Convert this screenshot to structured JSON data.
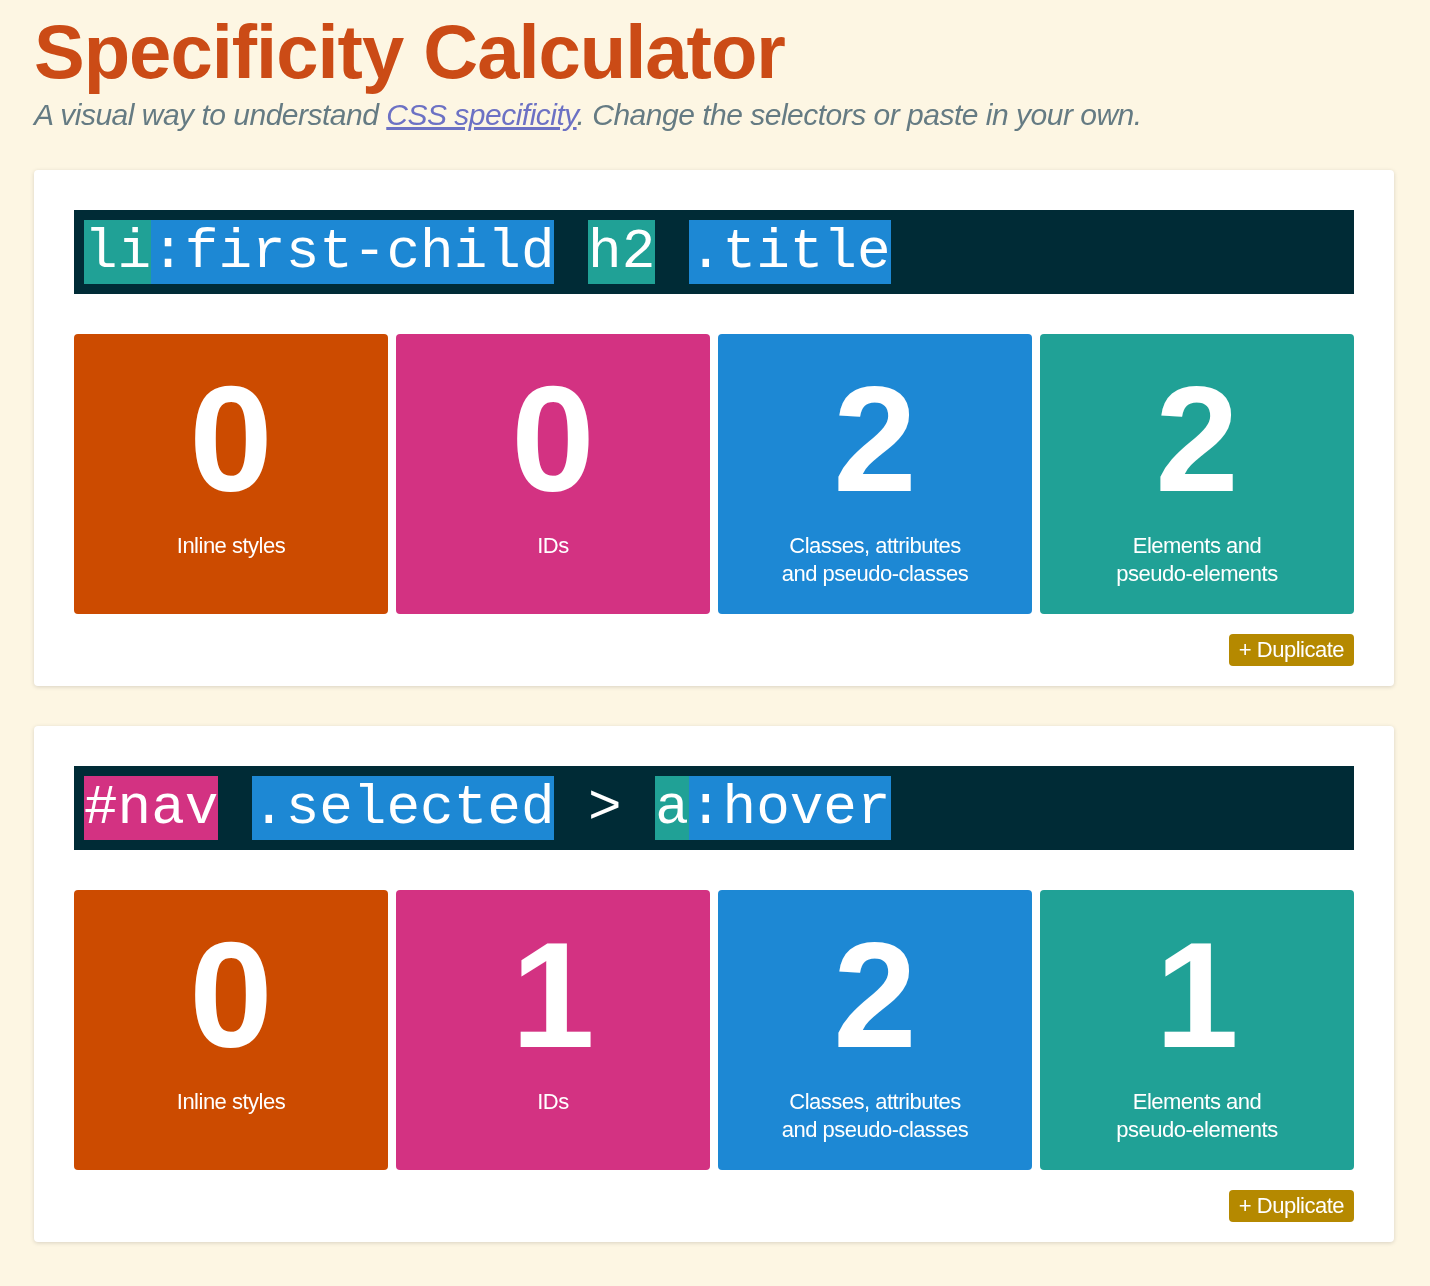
{
  "title": "Specificity Calculator",
  "subtitle": {
    "before": "A visual way to understand ",
    "link": "CSS specificity",
    "after": ". Change the selectors or paste in your own."
  },
  "calculators": [
    {
      "selector": [
        [
          {
            "text": "li",
            "kind": "element"
          },
          {
            "text": ":first-child",
            "kind": "class"
          }
        ],
        [
          {
            "text": "h2",
            "kind": "element"
          }
        ],
        [
          {
            "text": ".title",
            "kind": "class"
          }
        ]
      ],
      "counts": [
        {
          "kind": "inline",
          "value": "0",
          "label": "Inline styles"
        },
        {
          "kind": "id",
          "value": "0",
          "label": "IDs"
        },
        {
          "kind": "class",
          "value": "2",
          "label": "Classes, attributes and pseudo-classes"
        },
        {
          "kind": "element",
          "value": "2",
          "label": "Elements and pseudo-elements"
        }
      ],
      "button": "+ Duplicate"
    },
    {
      "selector": [
        [
          {
            "text": "#nav",
            "kind": "id"
          }
        ],
        [
          {
            "text": ".selected",
            "kind": "class"
          }
        ],
        [
          {
            "text": ">",
            "kind": "plain"
          }
        ],
        [
          {
            "text": "a",
            "kind": "element"
          },
          {
            "text": ":hover",
            "kind": "class"
          }
        ]
      ],
      "counts": [
        {
          "kind": "inline",
          "value": "0",
          "label": "Inline styles"
        },
        {
          "kind": "id",
          "value": "1",
          "label": "IDs"
        },
        {
          "kind": "class",
          "value": "2",
          "label": "Classes, attributes and pseudo-classes"
        },
        {
          "kind": "element",
          "value": "1",
          "label": "Elements and pseudo-elements"
        }
      ],
      "button": "+ Duplicate"
    }
  ]
}
